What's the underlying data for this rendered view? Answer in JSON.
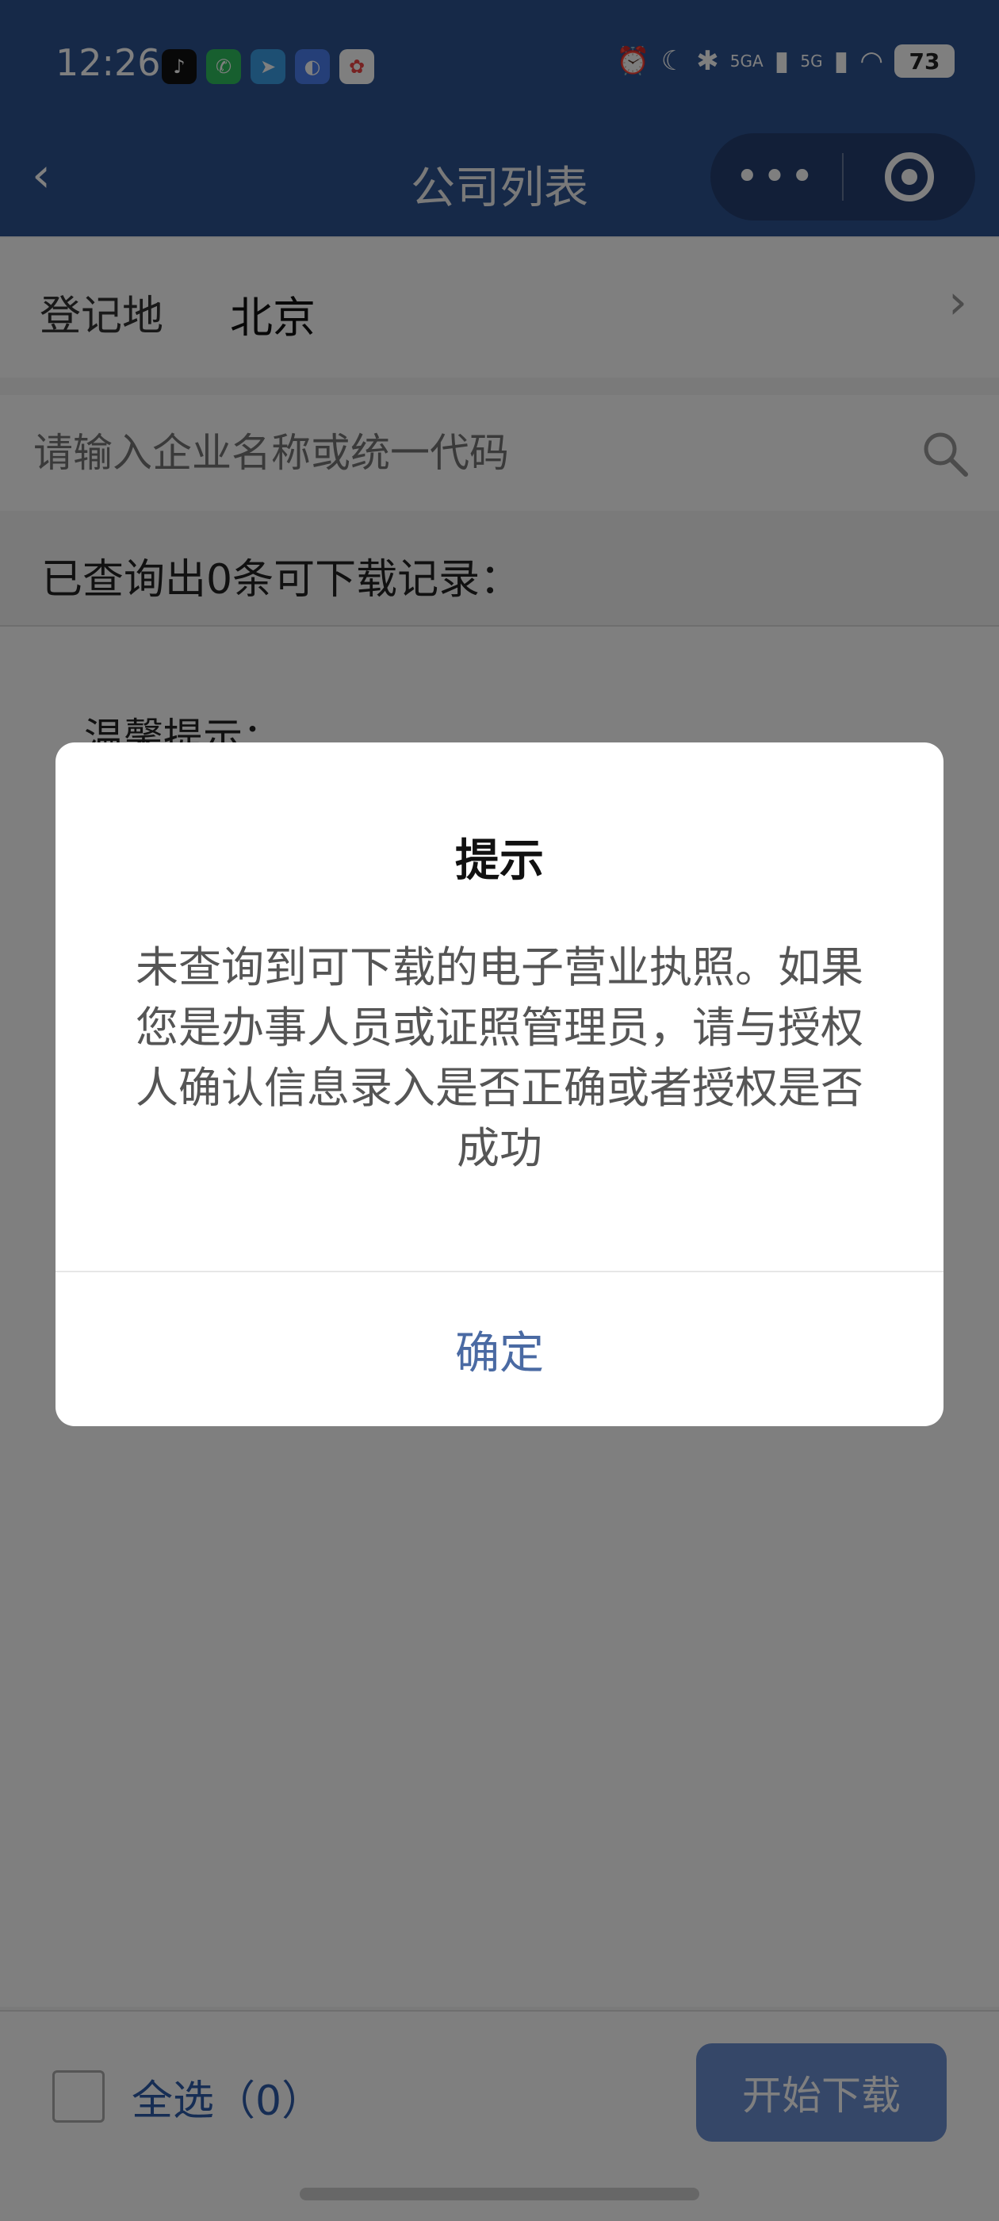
{
  "status": {
    "time": "12:26",
    "network1": "5GA",
    "network2": "5G",
    "battery": "73"
  },
  "nav": {
    "title": "公司列表",
    "more": "•••"
  },
  "filter": {
    "region_label": "登记地",
    "region_value": "北京"
  },
  "search": {
    "placeholder": "请输入企业名称或统一代码"
  },
  "result": {
    "count_text": "已查询出0条可下载记录："
  },
  "tips": {
    "title": "温馨提示："
  },
  "bottom": {
    "select_all": "全选（0）",
    "download": "开始下载"
  },
  "dialog": {
    "title": "提示",
    "message": "未查询到可下载的电子营业执照。如果您是办事人员或证照管理员，请与授权人确认信息录入是否正确或者授权是否成功",
    "confirm": "确定"
  },
  "colors": {
    "header": "#2d5290",
    "accent": "#2d5aa8",
    "button": "#6b8fd1"
  }
}
